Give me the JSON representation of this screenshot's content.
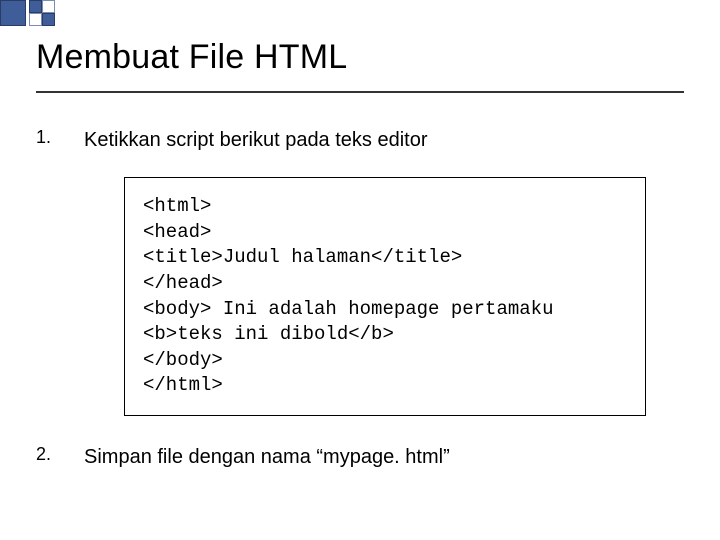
{
  "decoration": {
    "primary_color": "#3f5d99"
  },
  "title": "Membuat File HTML",
  "items": [
    {
      "number": "1.",
      "text": "Ketikkan script berikut pada teks editor"
    },
    {
      "number": "2.",
      "text": "Simpan file dengan nama “mypage. html”"
    }
  ],
  "code": "<html>\n<head>\n<title>Judul halaman</title>\n</head>\n<body> Ini adalah homepage pertamaku\n<b>teks ini dibold</b>\n</body>\n</html>"
}
